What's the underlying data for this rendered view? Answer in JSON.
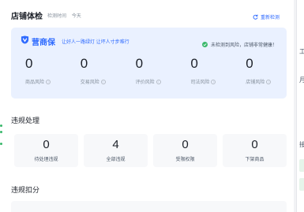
{
  "header": {
    "title": "店铺体检",
    "meta_label": "检测时间",
    "meta_value": "今天",
    "refresh_label": "重新检测"
  },
  "health": {
    "brand_name": "营商保",
    "slogan": "让好人一路绿灯 让坏人寸步难行",
    "status_text": "未检测到风险，店铺非常健康！",
    "risks": [
      {
        "value": "0",
        "label": "商品风险"
      },
      {
        "value": "0",
        "label": "交易风险"
      },
      {
        "value": "0",
        "label": "评价风险"
      },
      {
        "value": "0",
        "label": "司法风险"
      },
      {
        "value": "0",
        "label": "店铺风险"
      }
    ]
  },
  "violation": {
    "title": "违规处理",
    "items": [
      {
        "value": "0",
        "label": "待处理违规"
      },
      {
        "value": "4",
        "label": "全部违规"
      },
      {
        "value": "0",
        "label": "受限权限"
      },
      {
        "value": "0",
        "label": "下架商品"
      }
    ]
  },
  "deduction": {
    "title": "违规扣分"
  },
  "right_panel": {
    "chars": [
      "工",
      "月",
      "接"
    ]
  },
  "colors": {
    "accent": "#2f6bff",
    "success": "#3ab86b",
    "card_bg": "#eaf1ff"
  }
}
